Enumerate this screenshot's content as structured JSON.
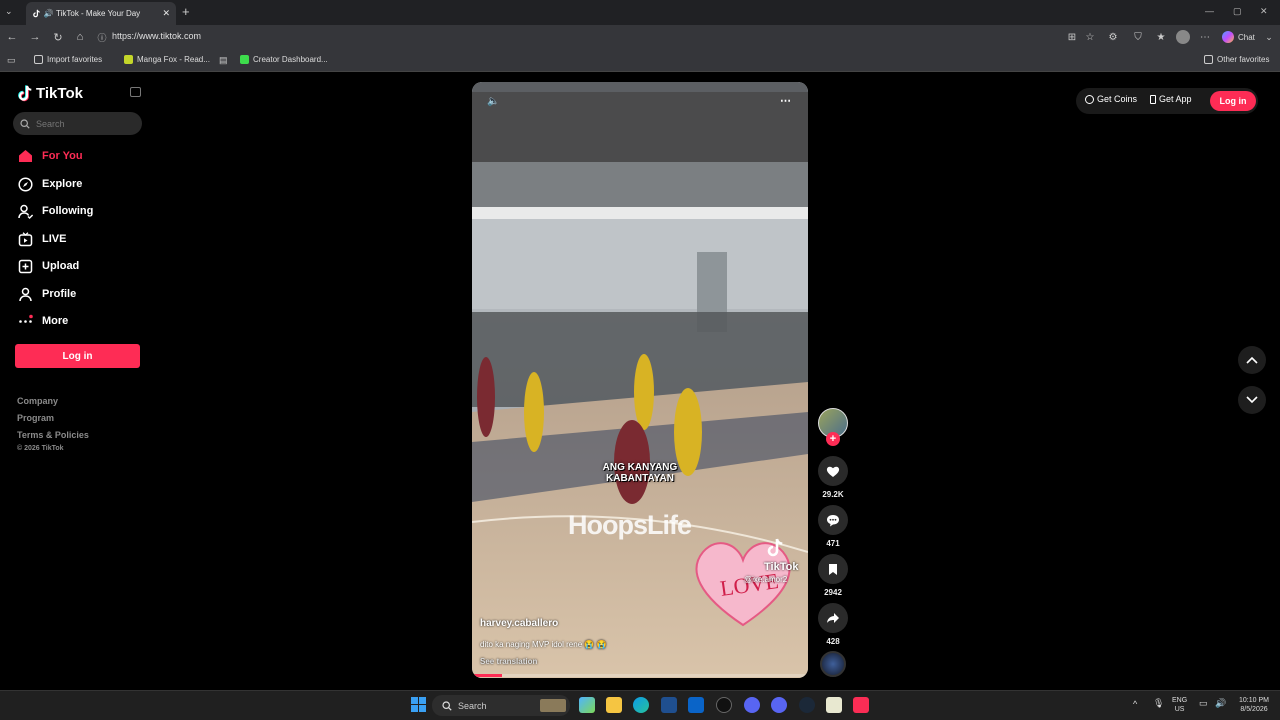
{
  "browser": {
    "tab_title": "TikTok - Make Your Day",
    "url": "https://www.tiktok.com",
    "chat_label": "Chat",
    "favorites": [
      {
        "label": "Import favorites"
      },
      {
        "label": "Manga Fox - Read..."
      },
      {
        "label": "Creator Dashboard..."
      }
    ],
    "other_favorites": "Other favorites"
  },
  "sidebar": {
    "logo": "TikTok",
    "search_placeholder": "Search",
    "nav": [
      {
        "label": "For You",
        "icon": "home-icon",
        "active": true
      },
      {
        "label": "Explore",
        "icon": "compass-icon"
      },
      {
        "label": "Following",
        "icon": "following-icon"
      },
      {
        "label": "LIVE",
        "icon": "live-icon"
      },
      {
        "label": "Upload",
        "icon": "upload-icon"
      },
      {
        "label": "Profile",
        "icon": "profile-icon"
      },
      {
        "label": "More",
        "icon": "more-icon"
      }
    ],
    "login": "Log in",
    "footer": [
      "Company",
      "Program",
      "Terms & Policies"
    ],
    "copyright": "© 2026 TikTok"
  },
  "header": {
    "get_coins": "Get Coins",
    "get_app": "Get App",
    "login": "Log in"
  },
  "video": {
    "overlay_caption": "ANG KANYANG KABANTAYAN",
    "watermark_brand": "HoopsLife",
    "tiktok_mark": "TikTok",
    "tiktok_handle": "@ixe.amor2",
    "sticker_text": "LOVE",
    "author": "harvey.caballero",
    "description": "dito ka naging MVP idol rene 😭 😭",
    "see_translation": "See translation",
    "progress": 0.09
  },
  "actions": {
    "likes": "29.2K",
    "comments": "471",
    "saves": "2942",
    "shares": "428"
  },
  "taskbar": {
    "search": "Search",
    "lang": "ENG",
    "region": "US",
    "time": "10:10 PM",
    "date": "8/5/2026"
  },
  "colors": {
    "accent": "#fe2c55",
    "background": "#000000"
  }
}
